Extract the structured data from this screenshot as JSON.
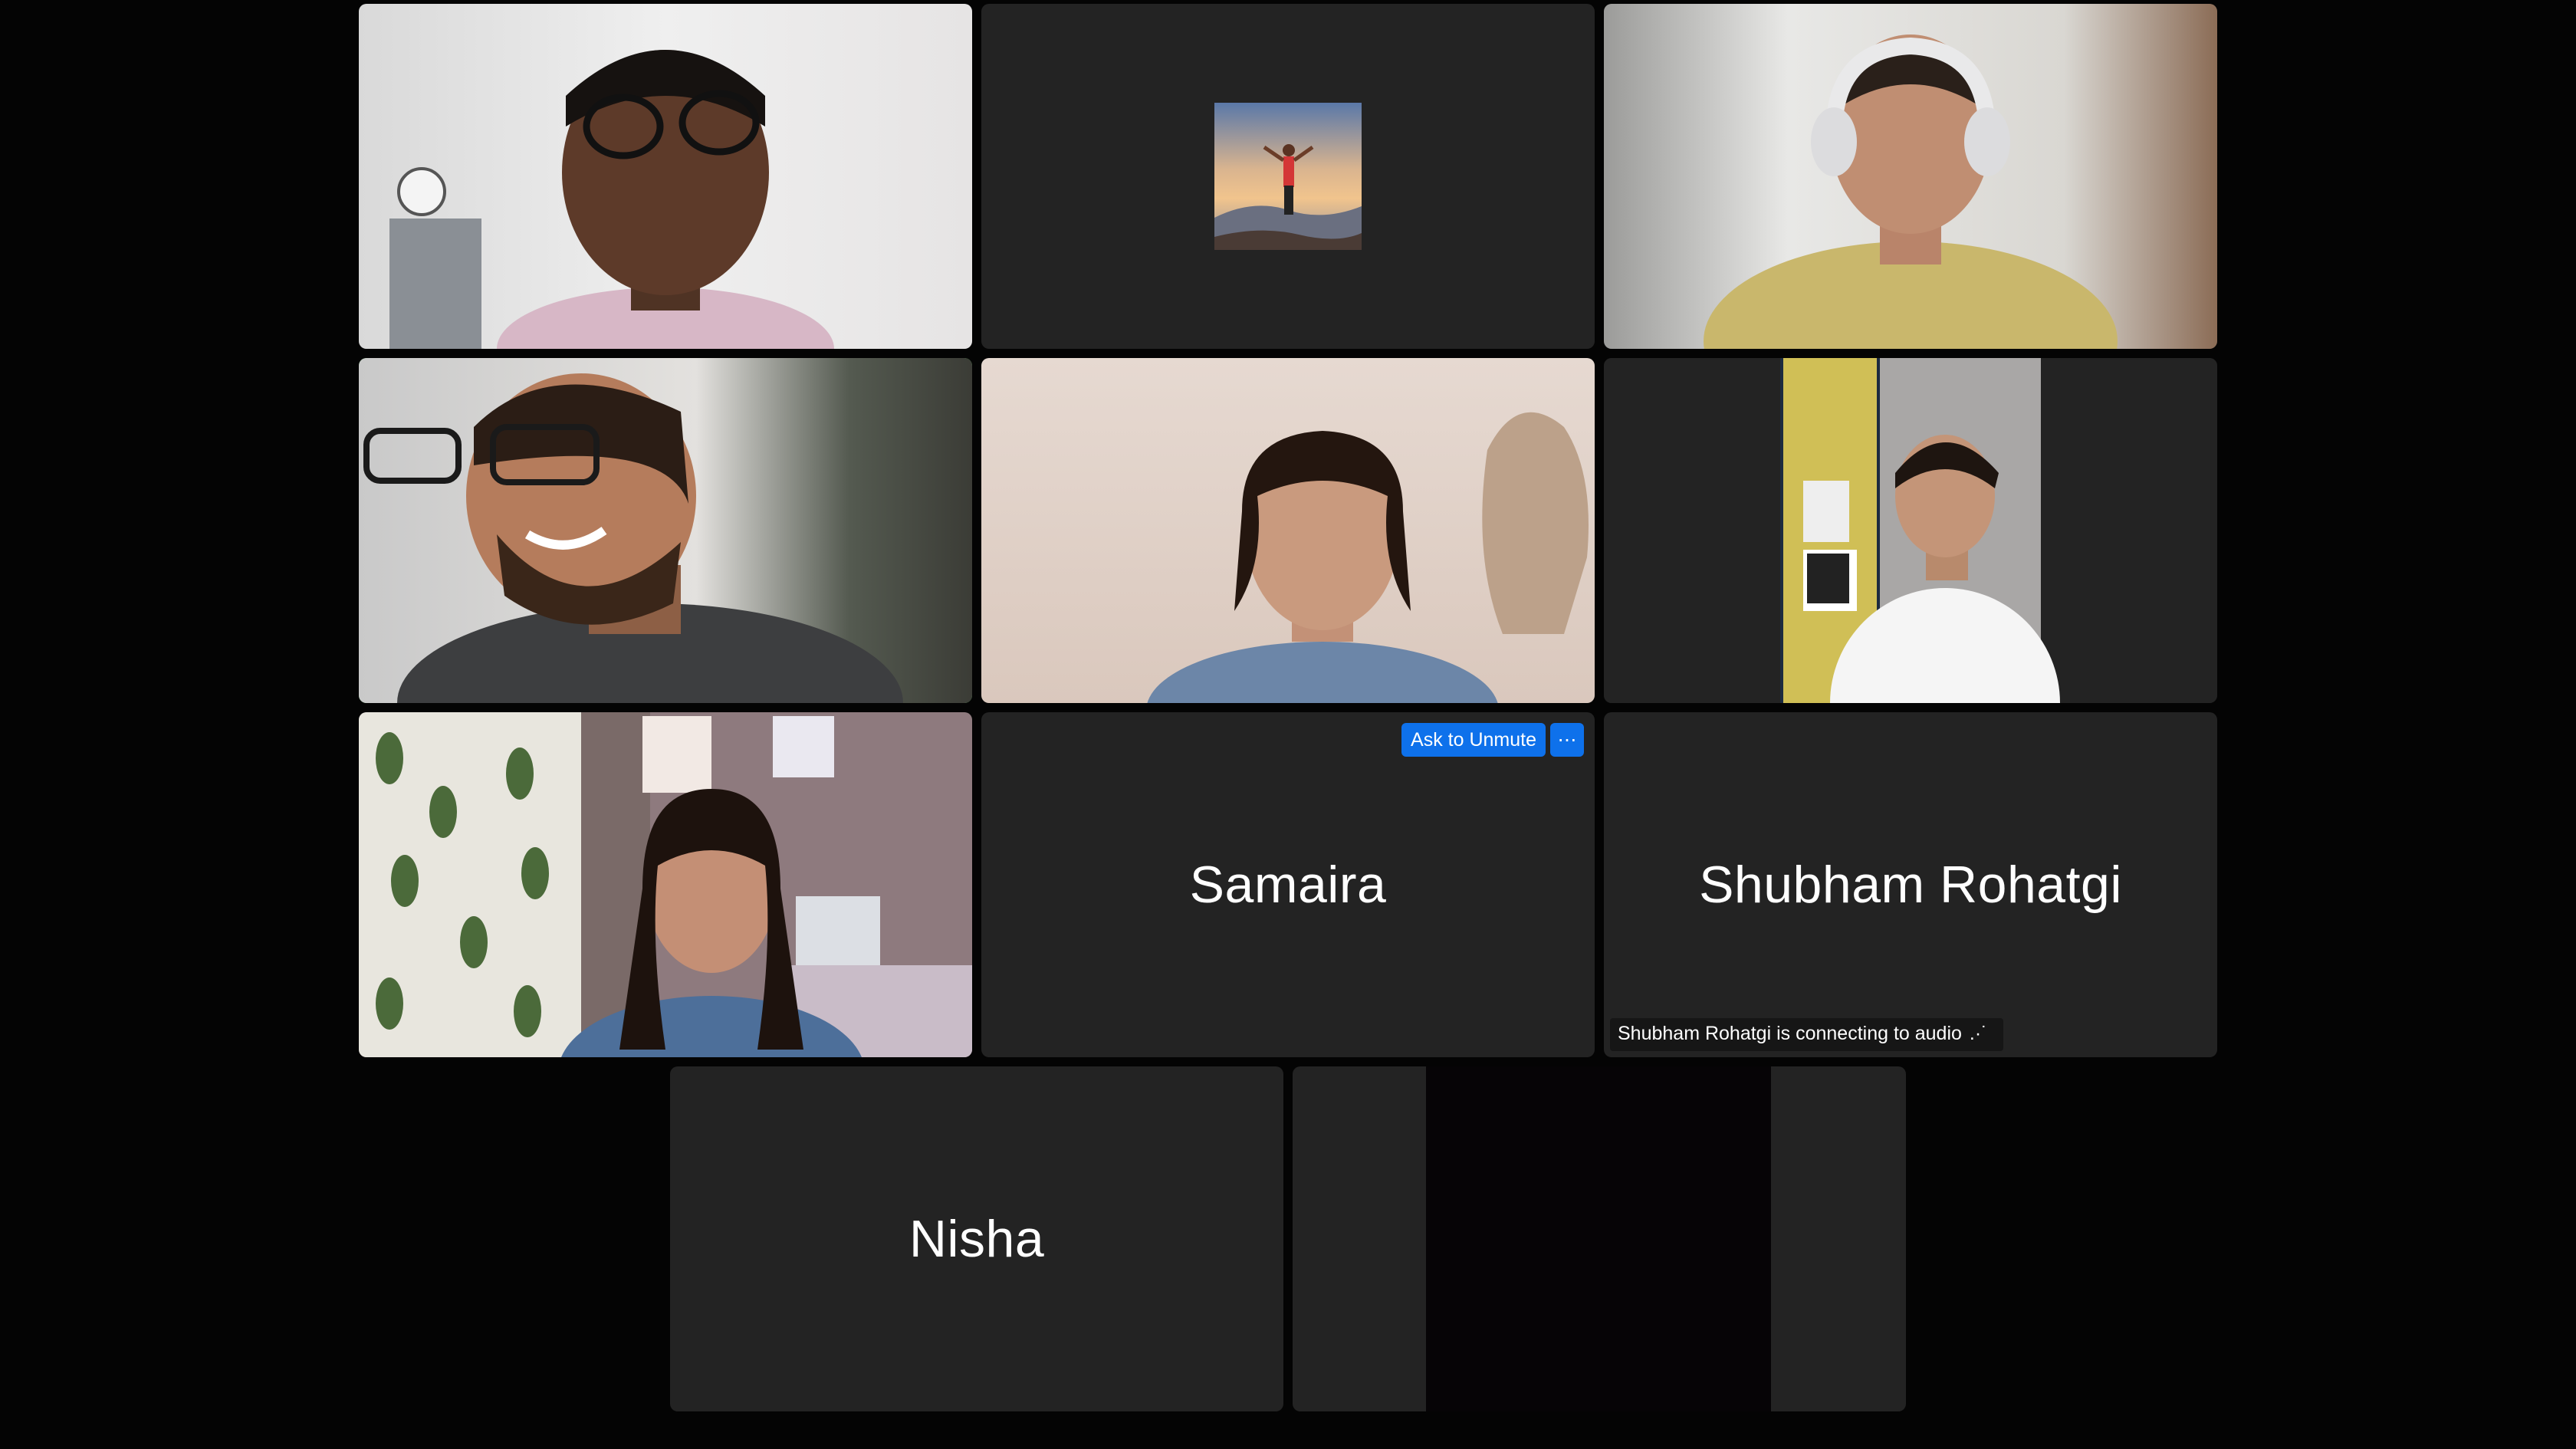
{
  "meeting": {
    "participants": [
      {
        "id": "p1",
        "name": "",
        "video": "on"
      },
      {
        "id": "p2",
        "name": "",
        "video": "off-photo"
      },
      {
        "id": "p3",
        "name": "",
        "video": "on"
      },
      {
        "id": "p4",
        "name": "",
        "video": "on",
        "speaking": true
      },
      {
        "id": "p5",
        "name": "",
        "video": "on"
      },
      {
        "id": "p6",
        "name": "",
        "video": "on"
      },
      {
        "id": "p7",
        "name": "",
        "video": "on"
      },
      {
        "id": "p8",
        "name": "Samaira",
        "video": "off",
        "ask_to_unmute_label": "Ask to Unmute",
        "more_label": "⋯"
      },
      {
        "id": "p9",
        "name": "Shubham Rohatgi",
        "video": "off",
        "status": "Shubham Rohatgi is connecting to audio",
        "status_dots": ".·˙"
      },
      {
        "id": "p10",
        "name": "Nisha",
        "video": "off"
      },
      {
        "id": "p11",
        "name": "",
        "video": "on-black"
      }
    ]
  },
  "colors": {
    "tile_bg": "#232323",
    "active_speaker_border": "#4fca58",
    "ask_button": "#0e71eb"
  }
}
